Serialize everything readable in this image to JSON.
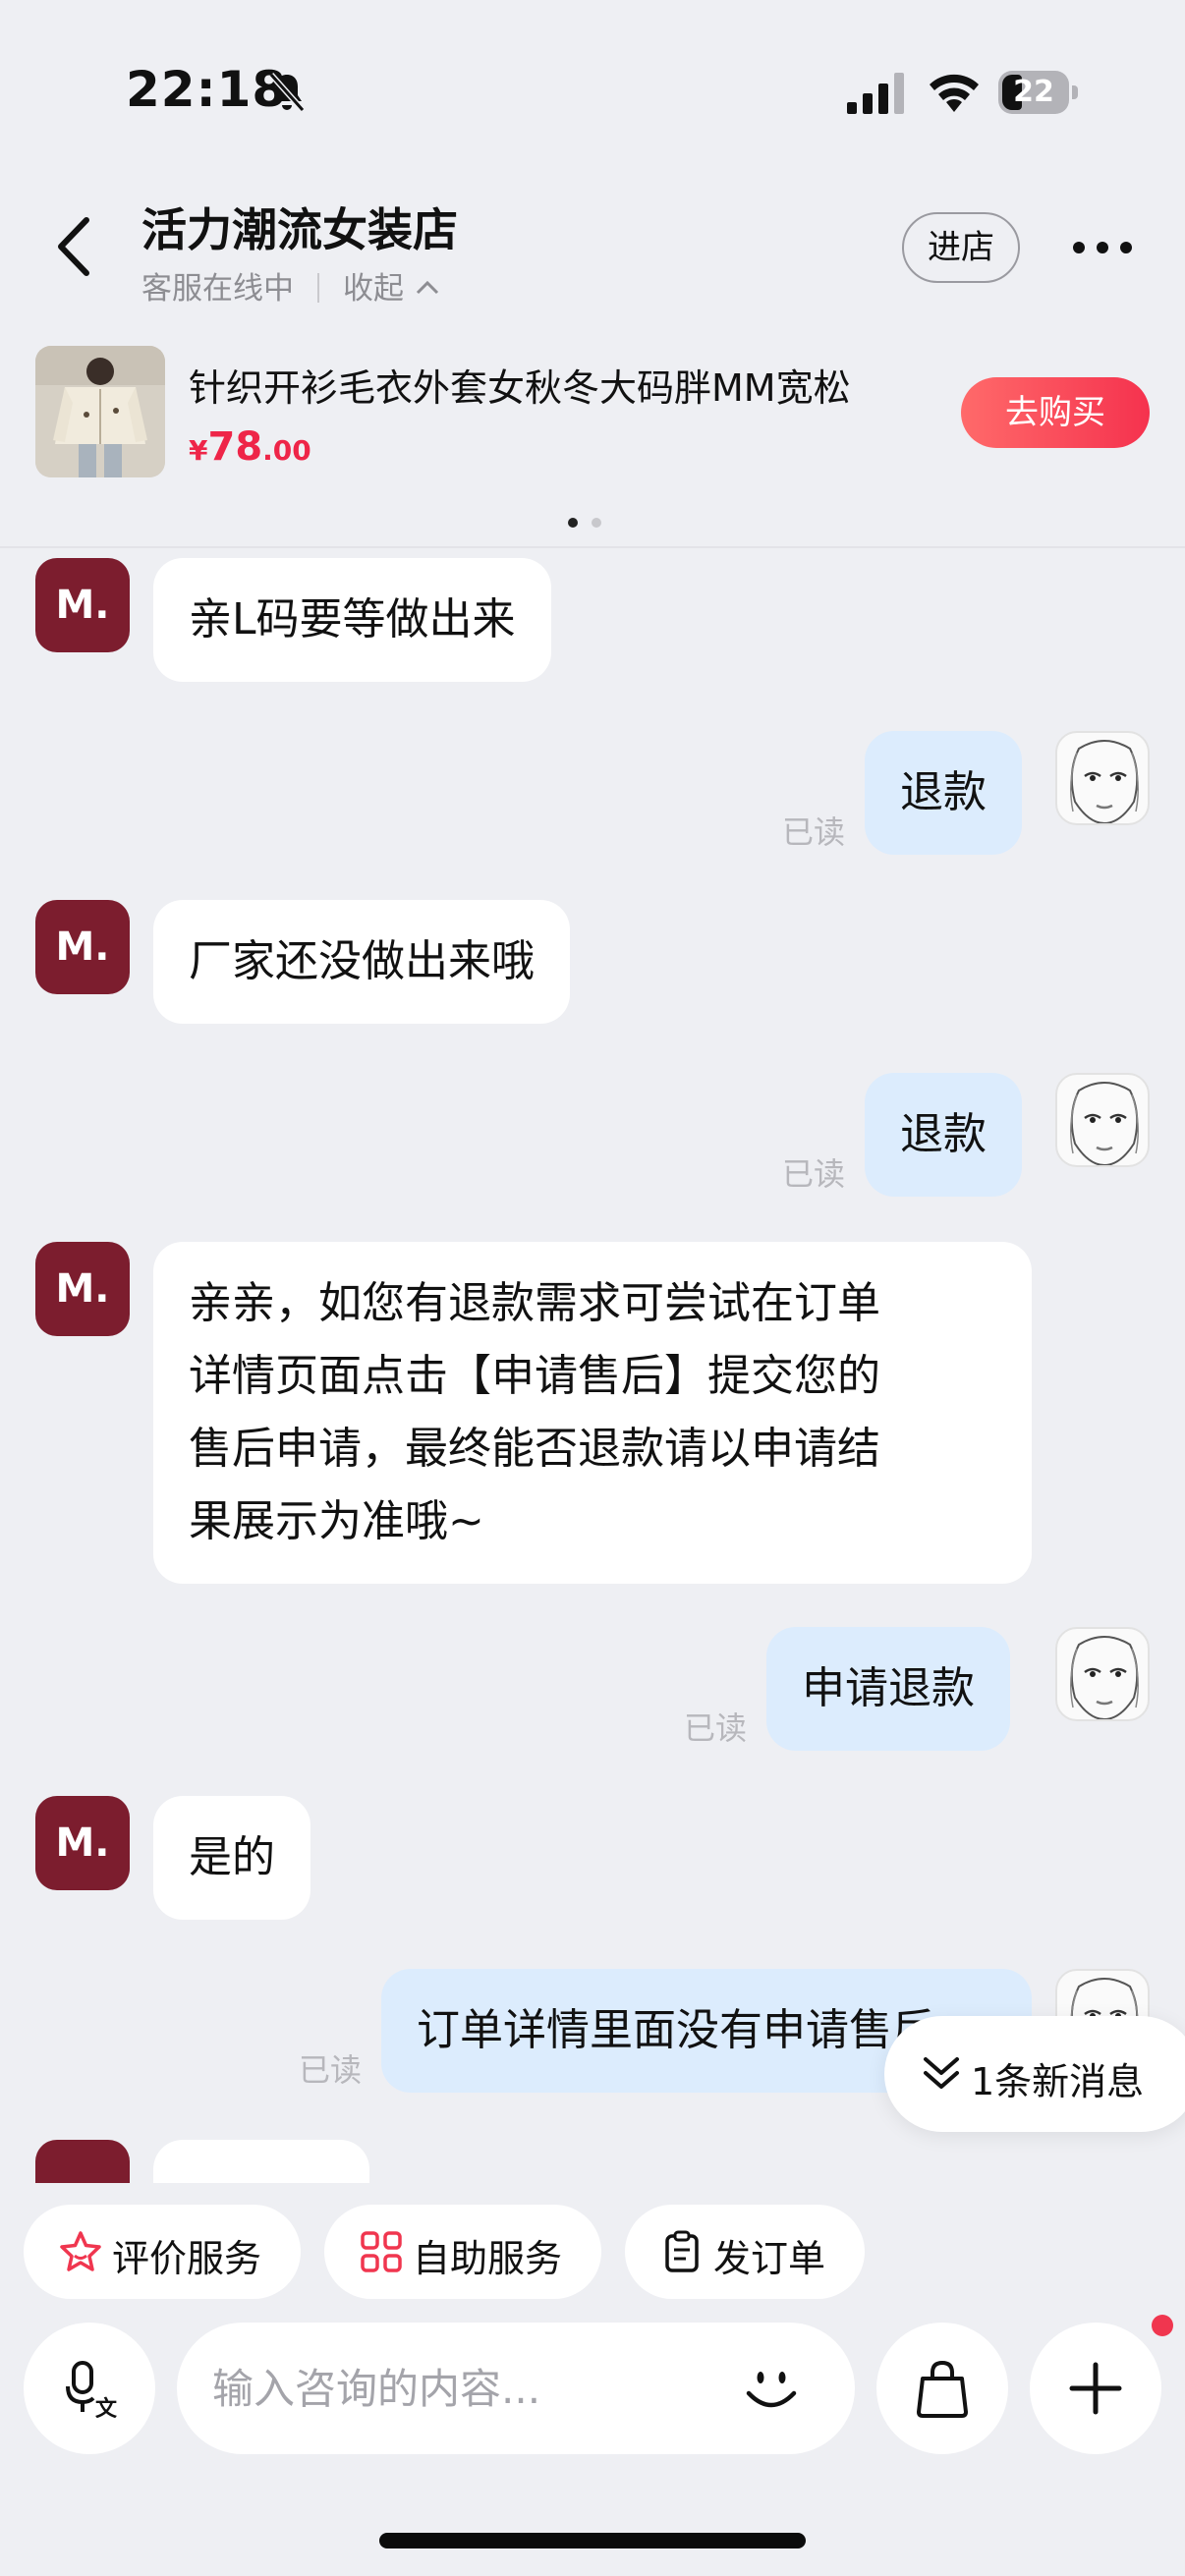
{
  "status_bar": {
    "time": "22:18",
    "battery": "22"
  },
  "header": {
    "shop_name": "活力潮流女装店",
    "status": "客服在线中",
    "collapse": "收起",
    "enter_shop": "进店",
    "more_icon": "more-horizontal-icon"
  },
  "product": {
    "title": "针织开衫毛衣外套女秋冬大码胖MM宽松",
    "price_currency": "¥",
    "price_int": "78",
    "price_dec": ".00",
    "buy_label": "去购买",
    "page_dots": 2,
    "active_dot": 0
  },
  "messages": [
    {
      "side": "in",
      "avatar": "M.",
      "text": "亲L码要等做出来"
    },
    {
      "side": "out",
      "text": "退款",
      "read": "已读"
    },
    {
      "side": "in",
      "avatar": "M.",
      "text": "厂家还没做出来哦"
    },
    {
      "side": "out",
      "text": "退款",
      "read": "已读"
    },
    {
      "side": "in",
      "avatar": "M.",
      "lines": [
        "亲亲，如您有退款需求可尝试在订单",
        "详情页面点击【申请售后】提交您的",
        "售后申请，最终能否退款请以申请结",
        "果展示为准哦~"
      ]
    },
    {
      "side": "out",
      "text": "申请退款",
      "read": "已读"
    },
    {
      "side": "in",
      "avatar": "M.",
      "text": "是的"
    },
    {
      "side": "out",
      "text": "订单详情里面没有申请售后",
      "read": "已读"
    }
  ],
  "new_messages": "1条新消息",
  "quick_actions": [
    {
      "label": "评价服务",
      "icon": "star-icon"
    },
    {
      "label": "自助服务",
      "icon": "grid-icon"
    },
    {
      "label": "发订单",
      "icon": "clipboard-icon"
    }
  ],
  "input": {
    "placeholder": "输入咨询的内容..."
  },
  "colors": {
    "accent_red": "#f5324e",
    "price_red": "#ee2548",
    "merchant_avatar": "#7c1d2e",
    "out_bubble": "#dcecfd",
    "background": "#eeeff3"
  }
}
